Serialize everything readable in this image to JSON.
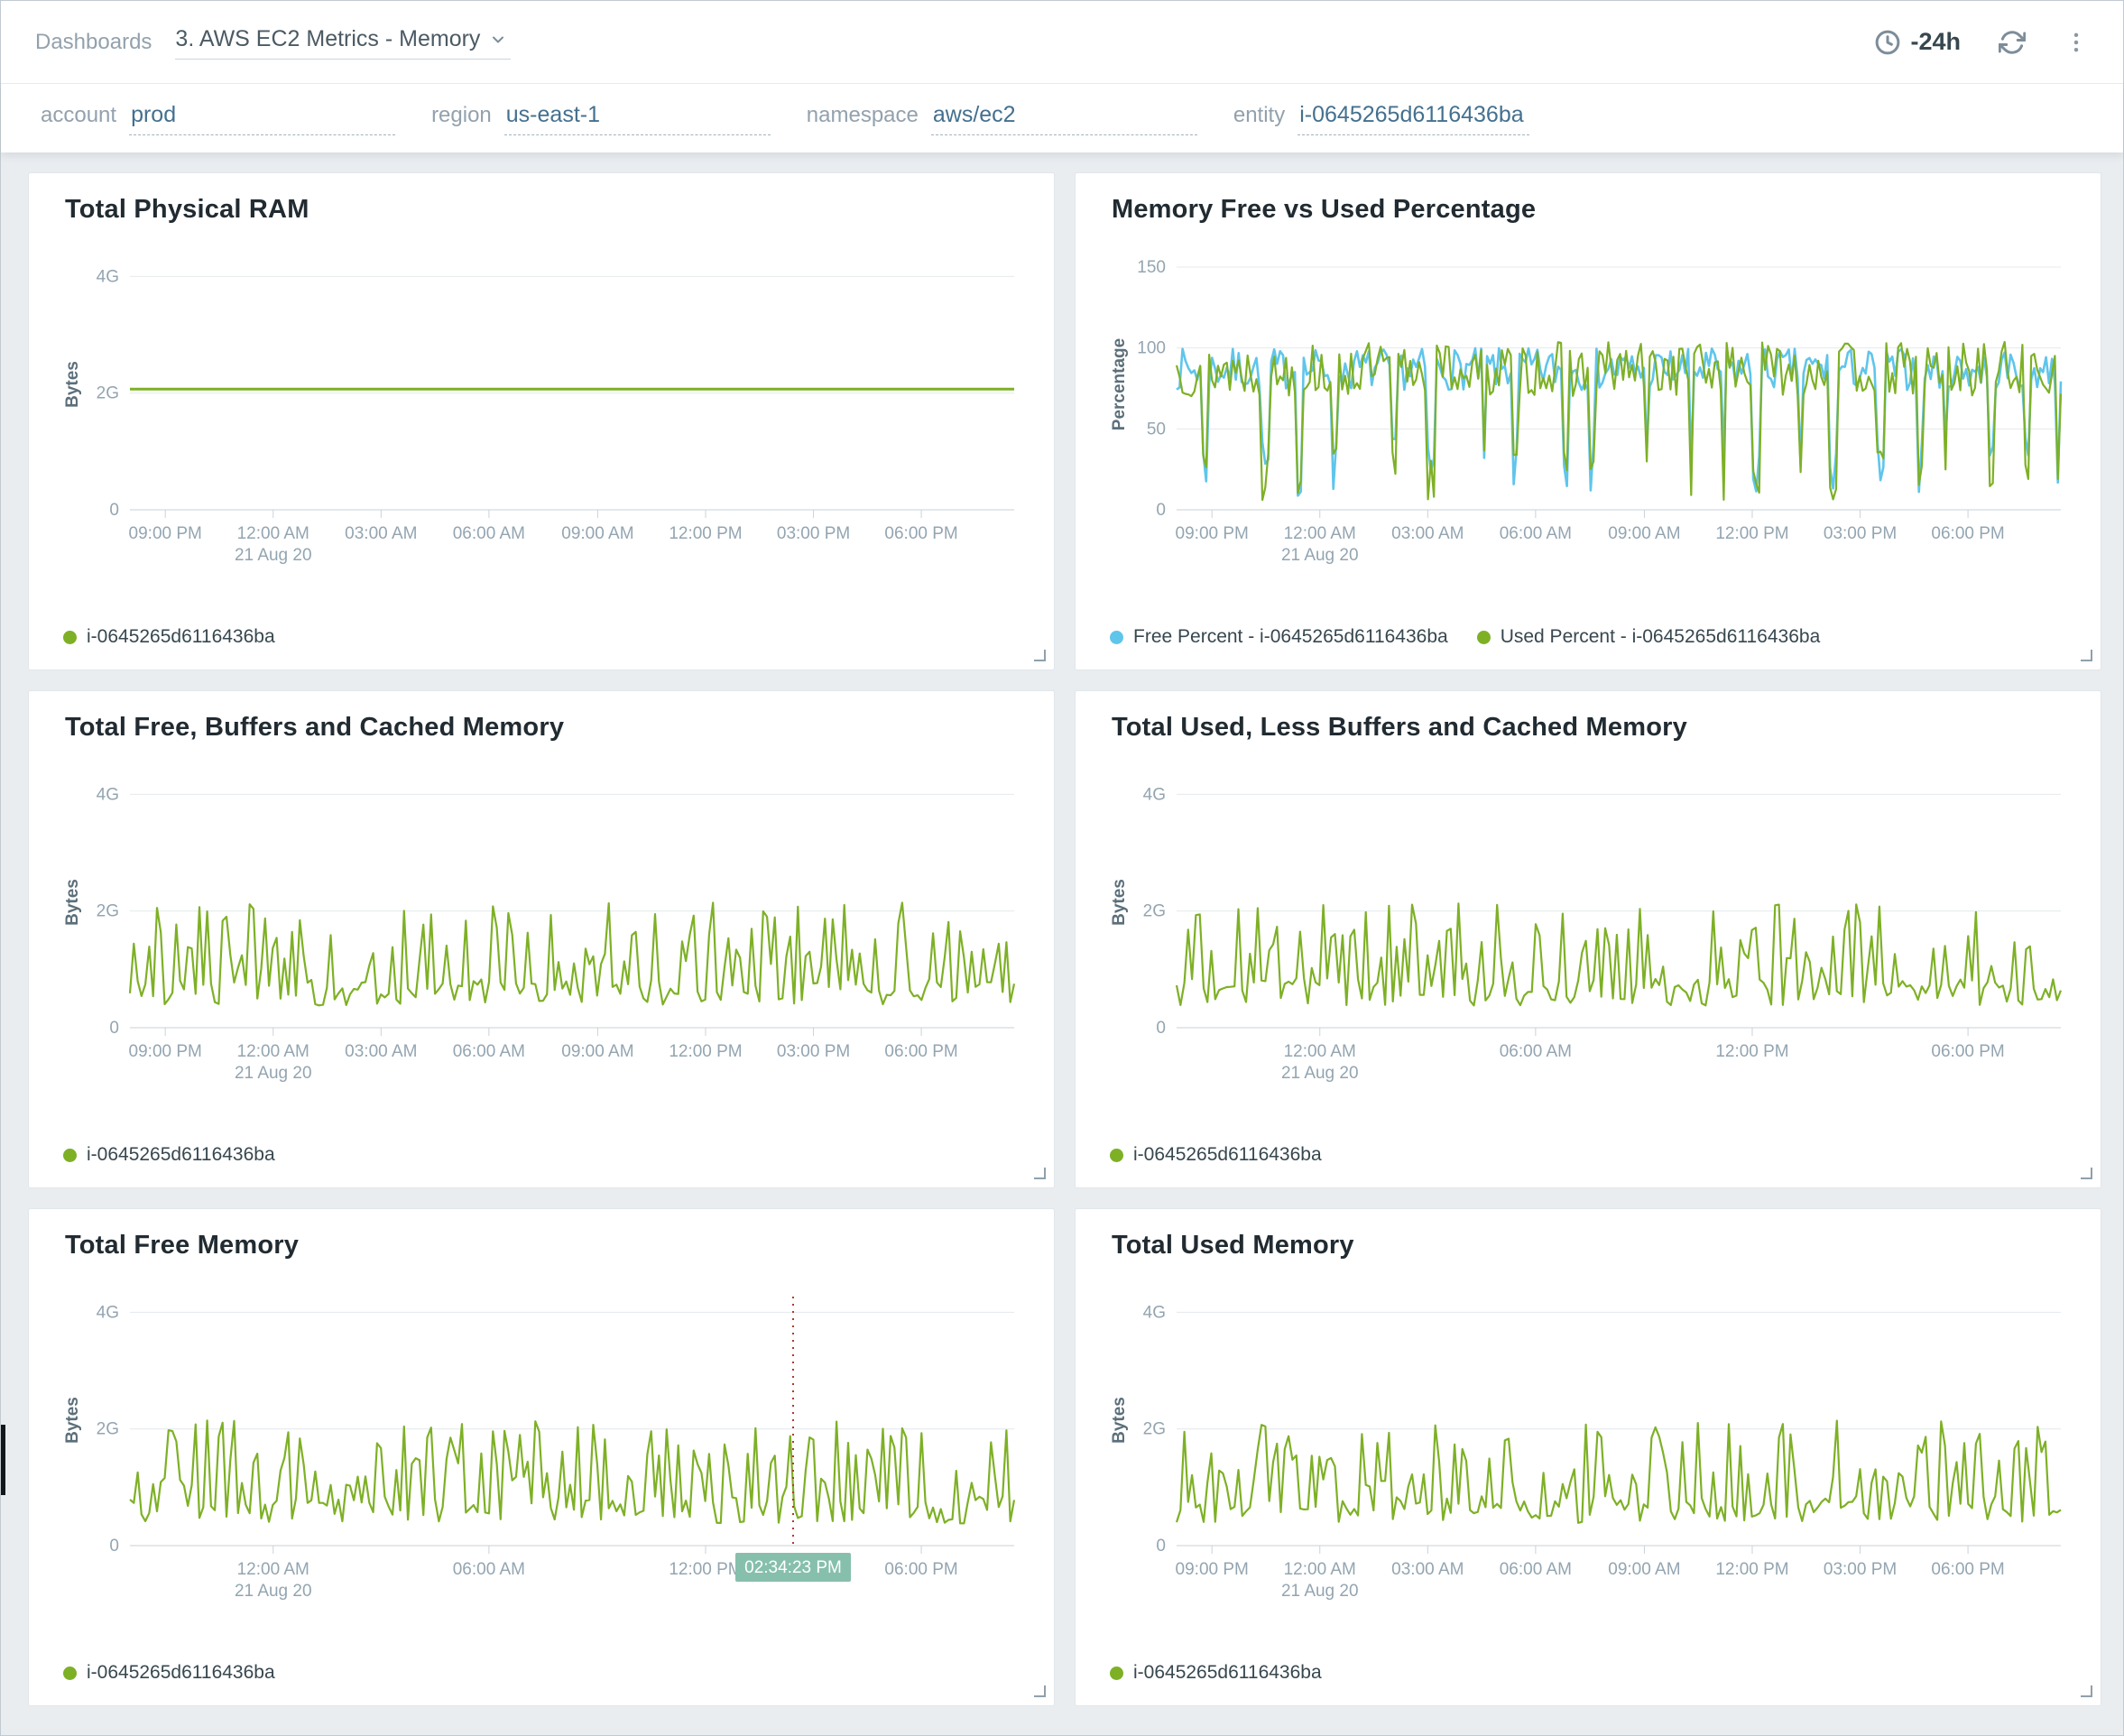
{
  "header": {
    "breadcrumb": "Dashboards",
    "dashboard_name": "3. AWS EC2 Metrics - Memory",
    "time_range": "-24h",
    "icons": [
      "clock-icon",
      "refresh-icon",
      "kebab-menu-icon",
      "chevron-down-icon"
    ]
  },
  "filters": [
    {
      "label": "account",
      "value": "prod"
    },
    {
      "label": "region",
      "value": "us-east-1"
    },
    {
      "label": "namespace",
      "value": "aws/ec2"
    },
    {
      "label": "entity",
      "value": "i-0645265d6116436ba"
    }
  ],
  "colors": {
    "green": "#7EB026",
    "blue": "#5FC5EB",
    "grid": "#e4e9ec",
    "axis": "#c9d2d8",
    "crosshair_line": "#b03a2e",
    "tooltip_bg": "#87bfad"
  },
  "chart_data": [
    {
      "type": "line",
      "title": "Total Physical RAM",
      "ylabel": "Bytes",
      "unit": "G",
      "ylim": [
        0,
        4.3
      ],
      "yticks": [
        {
          "v": 0,
          "label": "0"
        },
        {
          "v": 2,
          "label": "2G"
        },
        {
          "v": 4,
          "label": "4G"
        }
      ],
      "xticks": [
        {
          "f": 0.04,
          "label": "09:00 PM"
        },
        {
          "f": 0.162,
          "label": "12:00 AM",
          "sub": "21 Aug 20"
        },
        {
          "f": 0.284,
          "label": "03:00 AM"
        },
        {
          "f": 0.406,
          "label": "06:00 AM"
        },
        {
          "f": 0.529,
          "label": "09:00 AM"
        },
        {
          "f": 0.651,
          "label": "12:00 PM"
        },
        {
          "f": 0.773,
          "label": "03:00 PM"
        },
        {
          "f": 0.895,
          "label": "06:00 PM"
        }
      ],
      "series": [
        {
          "name": "i-0645265d6116436ba",
          "color": "#7EB026",
          "stroke_width": 3,
          "gen": {
            "type": "flat",
            "value": 2.07,
            "n": 16
          }
        }
      ],
      "legend": [
        {
          "color": "#7EB026",
          "label": "i-0645265d6116436ba"
        }
      ]
    },
    {
      "type": "line",
      "title": "Memory Free vs Used Percentage",
      "ylabel": "Percentage",
      "unit": "%",
      "ylim": [
        0,
        155
      ],
      "yticks": [
        {
          "v": 0,
          "label": "0"
        },
        {
          "v": 50,
          "label": "50"
        },
        {
          "v": 100,
          "label": "100"
        },
        {
          "v": 150,
          "label": "150"
        }
      ],
      "xticks": [
        {
          "f": 0.04,
          "label": "09:00 PM"
        },
        {
          "f": 0.162,
          "label": "12:00 AM",
          "sub": "21 Aug 20"
        },
        {
          "f": 0.284,
          "label": "03:00 AM"
        },
        {
          "f": 0.406,
          "label": "06:00 AM"
        },
        {
          "f": 0.529,
          "label": "09:00 AM"
        },
        {
          "f": 0.651,
          "label": "12:00 PM"
        },
        {
          "f": 0.773,
          "label": "03:00 PM"
        },
        {
          "f": 0.895,
          "label": "06:00 PM"
        }
      ],
      "series": [
        {
          "name": "Free Percent - i-0645265d6116436ba",
          "color": "#5FC5EB",
          "stroke_width": 2.6,
          "gen": {
            "type": "percent",
            "n": 300,
            "seed": 7,
            "dipSeed": 42,
            "baseMin": 74,
            "baseMax": 100,
            "dipMin": 8,
            "dipMax": 45
          }
        },
        {
          "name": "Used Percent - i-0645265d6116436ba",
          "color": "#7EB026",
          "stroke_width": 2.2,
          "gen": {
            "type": "percent",
            "n": 300,
            "seed": 13,
            "dipSeed": 42,
            "baseMin": 70,
            "baseMax": 104,
            "dipMin": 4,
            "dipMax": 38
          }
        }
      ],
      "legend": [
        {
          "color": "#5FC5EB",
          "label": "Free Percent - i-0645265d6116436ba"
        },
        {
          "color": "#7EB026",
          "label": "Used Percent - i-0645265d6116436ba"
        }
      ]
    },
    {
      "type": "line",
      "title": "Total Free, Buffers and Cached Memory",
      "ylabel": "Bytes",
      "unit": "G",
      "ylim": [
        0,
        4.3
      ],
      "yticks": [
        {
          "v": 0,
          "label": "0"
        },
        {
          "v": 2,
          "label": "2G"
        },
        {
          "v": 4,
          "label": "4G"
        }
      ],
      "xticks": [
        {
          "f": 0.04,
          "label": "09:00 PM"
        },
        {
          "f": 0.162,
          "label": "12:00 AM",
          "sub": "21 Aug 20"
        },
        {
          "f": 0.284,
          "label": "03:00 AM"
        },
        {
          "f": 0.406,
          "label": "06:00 AM"
        },
        {
          "f": 0.529,
          "label": "09:00 AM"
        },
        {
          "f": 0.651,
          "label": "12:00 PM"
        },
        {
          "f": 0.773,
          "label": "03:00 PM"
        },
        {
          "f": 0.895,
          "label": "06:00 PM"
        }
      ],
      "series": [
        {
          "name": "i-0645265d6116436ba",
          "color": "#7EB026",
          "stroke_width": 2.2,
          "gen": {
            "type": "spiky",
            "n": 230,
            "seed": 21,
            "pHigh": 0.42,
            "lowMin": 0.38,
            "lowMax": 0.85,
            "highMin": 1.0,
            "highMax": 2.15
          }
        }
      ],
      "legend": [
        {
          "color": "#7EB026",
          "label": "i-0645265d6116436ba"
        }
      ]
    },
    {
      "type": "line",
      "title": "Total Used, Less Buffers and Cached Memory",
      "ylabel": "Bytes",
      "unit": "G",
      "ylim": [
        0,
        4.3
      ],
      "yticks": [
        {
          "v": 0,
          "label": "0"
        },
        {
          "v": 2,
          "label": "2G"
        },
        {
          "v": 4,
          "label": "4G"
        }
      ],
      "xticks": [
        {
          "f": 0.162,
          "label": "12:00 AM",
          "sub": "21 Aug 20"
        },
        {
          "f": 0.406,
          "label": "06:00 AM"
        },
        {
          "f": 0.651,
          "label": "12:00 PM"
        },
        {
          "f": 0.895,
          "label": "06:00 PM"
        }
      ],
      "series": [
        {
          "name": "i-0645265d6116436ba",
          "color": "#7EB026",
          "stroke_width": 2.2,
          "gen": {
            "type": "spiky",
            "n": 230,
            "seed": 33,
            "pHigh": 0.42,
            "lowMin": 0.38,
            "lowMax": 0.85,
            "highMin": 1.0,
            "highMax": 2.15
          }
        }
      ],
      "legend": [
        {
          "color": "#7EB026",
          "label": "i-0645265d6116436ba"
        }
      ]
    },
    {
      "type": "line",
      "title": "Total Free Memory",
      "ylabel": "Bytes",
      "unit": "G",
      "ylim": [
        0,
        4.3
      ],
      "yticks": [
        {
          "v": 0,
          "label": "0"
        },
        {
          "v": 2,
          "label": "2G"
        },
        {
          "v": 4,
          "label": "4G"
        }
      ],
      "xticks": [
        {
          "f": 0.162,
          "label": "12:00 AM",
          "sub": "21 Aug 20"
        },
        {
          "f": 0.406,
          "label": "06:00 AM"
        },
        {
          "f": 0.651,
          "label": "12:00 PM"
        },
        {
          "f": 0.895,
          "label": "06:00 PM"
        }
      ],
      "crosshair": {
        "f": 0.75,
        "label": "02:34:23 PM",
        "line_color": "#b03a2e",
        "bg": "#87bfad",
        "text_color": "#ffffff"
      },
      "series": [
        {
          "name": "i-0645265d6116436ba",
          "color": "#7EB026",
          "stroke_width": 2.2,
          "gen": {
            "type": "spiky",
            "n": 230,
            "seed": 55,
            "pHigh": 0.42,
            "lowMin": 0.38,
            "lowMax": 0.85,
            "highMin": 1.0,
            "highMax": 2.15
          }
        }
      ],
      "legend": [
        {
          "color": "#7EB026",
          "label": "i-0645265d6116436ba"
        }
      ]
    },
    {
      "type": "line",
      "title": "Total Used Memory",
      "ylabel": "Bytes",
      "unit": "G",
      "ylim": [
        0,
        4.3
      ],
      "yticks": [
        {
          "v": 0,
          "label": "0"
        },
        {
          "v": 2,
          "label": "2G"
        },
        {
          "v": 4,
          "label": "4G"
        }
      ],
      "xticks": [
        {
          "f": 0.04,
          "label": "09:00 PM"
        },
        {
          "f": 0.162,
          "label": "12:00 AM",
          "sub": "21 Aug 20"
        },
        {
          "f": 0.284,
          "label": "03:00 AM"
        },
        {
          "f": 0.406,
          "label": "06:00 AM"
        },
        {
          "f": 0.529,
          "label": "09:00 AM"
        },
        {
          "f": 0.651,
          "label": "12:00 PM"
        },
        {
          "f": 0.773,
          "label": "03:00 PM"
        },
        {
          "f": 0.895,
          "label": "06:00 PM"
        }
      ],
      "series": [
        {
          "name": "i-0645265d6116436ba",
          "color": "#7EB026",
          "stroke_width": 2.2,
          "gen": {
            "type": "spiky",
            "n": 230,
            "seed": 77,
            "pHigh": 0.42,
            "lowMin": 0.38,
            "lowMax": 0.85,
            "highMin": 1.0,
            "highMax": 2.15
          }
        }
      ],
      "legend": [
        {
          "color": "#7EB026",
          "label": "i-0645265d6116436ba"
        }
      ]
    }
  ]
}
